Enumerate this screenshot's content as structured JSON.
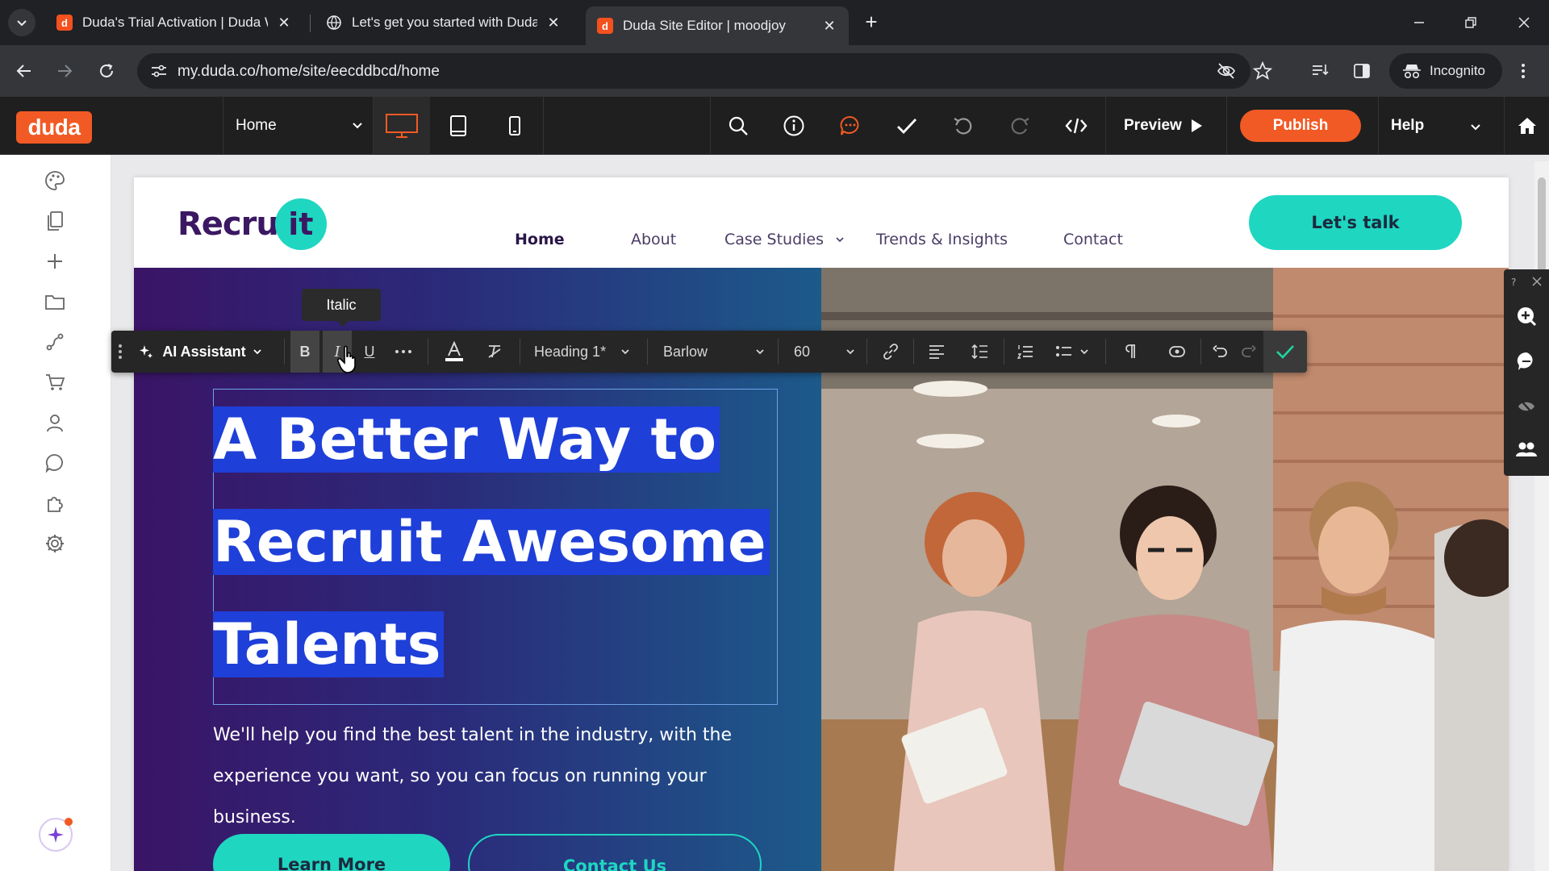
{
  "browser": {
    "tabs": [
      {
        "title": "Duda's Trial Activation | Duda W"
      },
      {
        "title": "Let's get you started with Duda"
      },
      {
        "title": "Duda Site Editor | moodjoy"
      }
    ],
    "url": "my.duda.co/home/site/eecddbcd/home",
    "incognito_label": "Incognito"
  },
  "editor": {
    "logo": "duda",
    "page_select": "Home",
    "preview_label": "Preview",
    "publish_label": "Publish",
    "help_label": "Help"
  },
  "site": {
    "logo_text": "Recru",
    "logo_badge": "it",
    "nav": [
      "Home",
      "About",
      "Case Studies",
      "Trends & Insights",
      "Contact"
    ],
    "cta_label": "Let's talk",
    "headline_lines": [
      "A Better Way to",
      "Recruit Awesome",
      "Talents"
    ],
    "subtext_lines": [
      "We'll help you find the best talent in the industry, with the",
      "experience you want, so you can focus on running your business."
    ],
    "learn_more_label": "Learn More",
    "contact_us_label": "Contact Us"
  },
  "text_toolbar": {
    "ai_label": "AI Assistant",
    "bold": "B",
    "italic": "I",
    "underline": "U",
    "tooltip": "Italic",
    "style_select": "Heading 1*",
    "font_select": "Barlow",
    "size_select": "60"
  },
  "colors": {
    "duda_orange": "#f15a24",
    "teal": "#1fd6c1",
    "selection": "#1e3fd8"
  }
}
